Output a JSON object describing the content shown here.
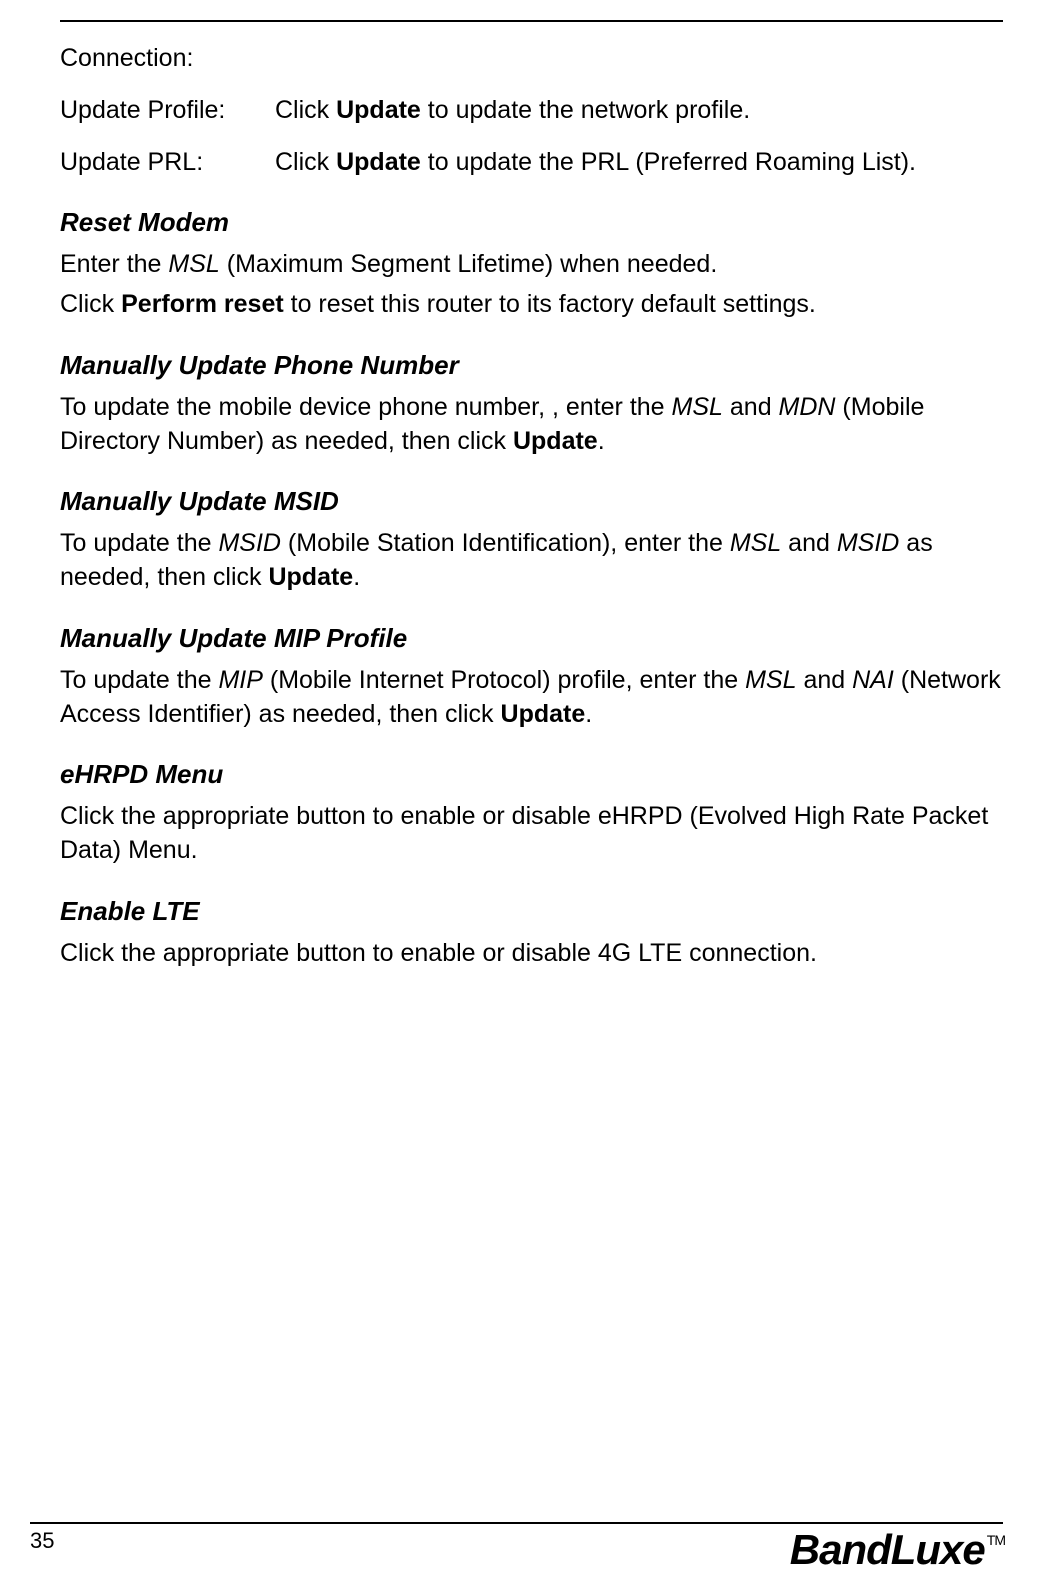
{
  "defs": {
    "connection_label": "Connection:",
    "update_profile_label": "Update Profile:",
    "update_profile_pre": "Click ",
    "update_profile_bold": "Update",
    "update_profile_post": " to update the network profile.",
    "update_prl_label": "Update PRL:",
    "update_prl_pre": "Click ",
    "update_prl_bold": "Update",
    "update_prl_post": " to update the PRL (Preferred Roaming List)."
  },
  "sections": {
    "reset_modem": {
      "heading": "Reset Modem",
      "line1_pre": "Enter the ",
      "line1_it": "MSL",
      "line1_post": " (Maximum Segment Lifetime) when needed.",
      "line2_pre": "Click ",
      "line2_bold": "Perform reset",
      "line2_post": " to reset this router to its factory default settings."
    },
    "mup_phone": {
      "heading": "Manually Update Phone Number",
      "pre": "To update the mobile device phone number, , enter the ",
      "it1": "MSL",
      "mid1": " and ",
      "it2": "MDN",
      "mid2": " (Mobile Directory Number) as needed, then click ",
      "bold": "Update",
      "post": "."
    },
    "mup_msid": {
      "heading": "Manually Update MSID",
      "pre": "To update the ",
      "it1": "MSID",
      "mid1": " (Mobile Station Identification), enter the ",
      "it2": "MSL",
      "mid2": " and ",
      "it3": "MSID",
      "mid3": " as needed, then click ",
      "bold": "Update",
      "post": "."
    },
    "mup_mip": {
      "heading": "Manually Update MIP Profile",
      "pre": "To update the ",
      "it1": "MIP",
      "mid1": " (Mobile Internet Protocol) profile, enter the ",
      "it2": "MSL",
      "mid2": " and ",
      "it3": "NAI",
      "mid3": " (Network Access Identifier) as needed, then click ",
      "bold": "Update",
      "post": "."
    },
    "ehrpd": {
      "heading": "eHRPD Menu",
      "text": "Click the appropriate button to enable or disable eHRPD (Evolved High Rate Packet Data) Menu."
    },
    "enable_lte": {
      "heading": "Enable LTE",
      "text": "Click the appropriate button to enable or disable 4G LTE connection."
    }
  },
  "footer": {
    "page_number": "35",
    "brand": "BandLuxe",
    "tm": "TM"
  }
}
